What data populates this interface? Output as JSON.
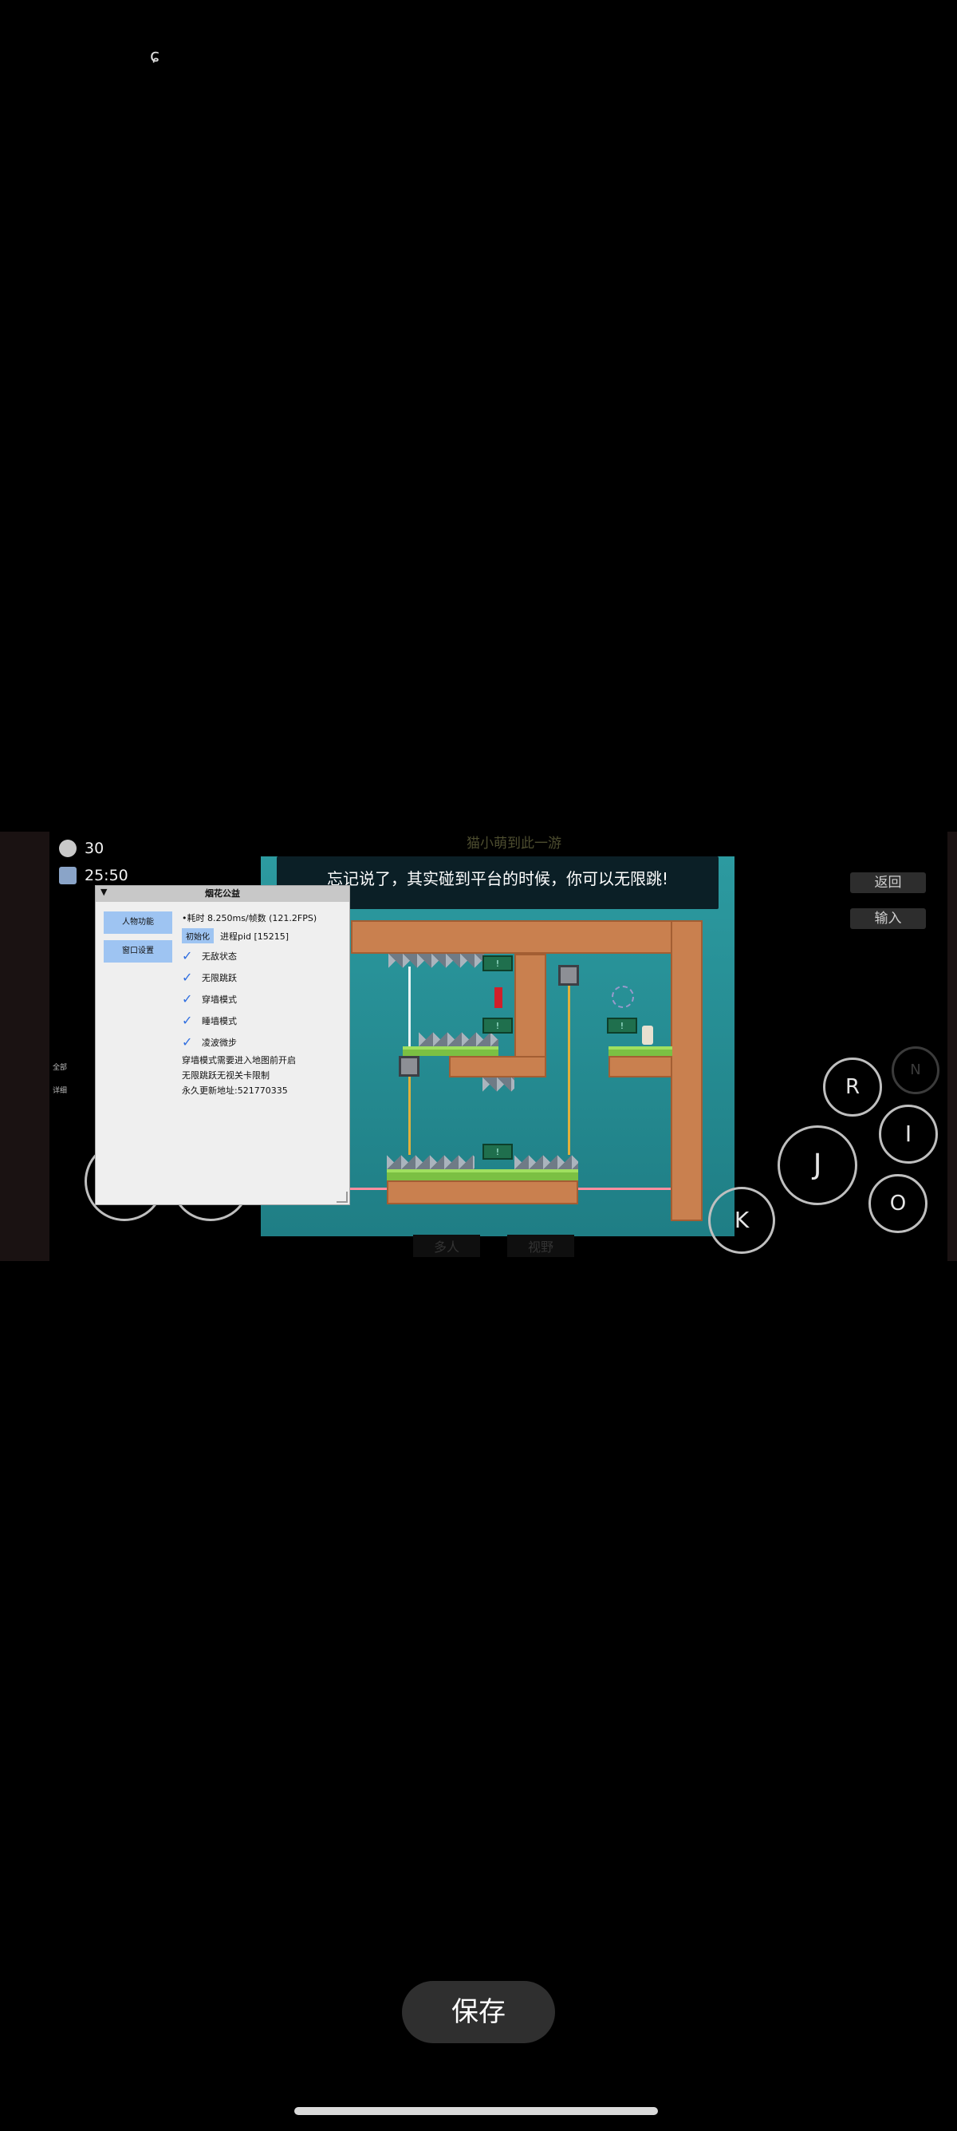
{
  "status": {
    "glyph": "ɕ"
  },
  "hud": {
    "deaths": "30",
    "time": "25:50",
    "title": "猫小萌到此一游"
  },
  "dialog": {
    "text": "忘记说了，其实碰到平台的时候，你可以无限跳!"
  },
  "level": {
    "sign_label": "!"
  },
  "right_buttons": {
    "back": "返回",
    "input": "输入"
  },
  "controls": {
    "R": "R",
    "N": "N",
    "I": "I",
    "J": "J",
    "O": "O",
    "K": "K"
  },
  "side_labels": {
    "a": "全部",
    "b": "详细"
  },
  "bottom_ghost": {
    "a": "多人",
    "b": "视野"
  },
  "panel": {
    "title": "烟花公益",
    "toggle": "▼",
    "tabs": [
      "人物功能",
      "窗口设置"
    ],
    "fps_line": "•耗时 8.250ms/帧数 (121.2FPS)",
    "init_button": "初始化",
    "pid_line": "进程pid [15215]",
    "options": [
      "无敌状态",
      "无限跳跃",
      "穿墙模式",
      "睡墙模式",
      "凌波微步"
    ],
    "notes": [
      "穿墙模式需要进入地图前开启",
      "无限跳跃无视关卡限制",
      "永久更新地址:521770335"
    ]
  },
  "save_button": "保存",
  "colors": {
    "background": "#000000",
    "viewport": "#2a8f94",
    "dirt": "#c9804f",
    "grass": "#7bc043",
    "panel": "#efefef",
    "panel_button": "#9ec4f2",
    "check": "#2f6ee0"
  }
}
